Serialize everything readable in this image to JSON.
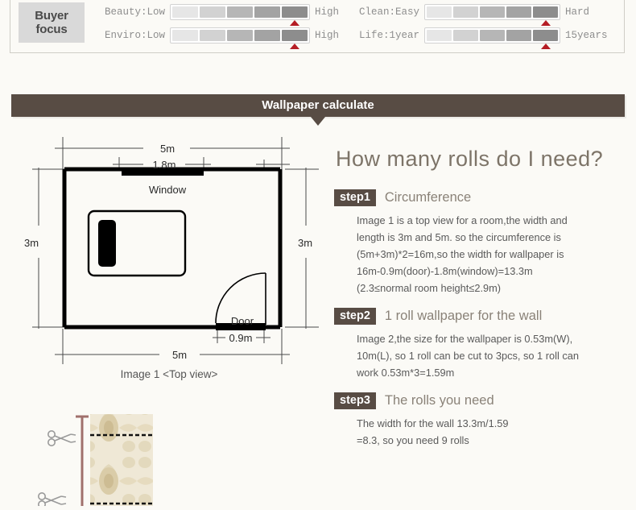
{
  "buyer_focus": {
    "badge_line1": "Buyer",
    "badge_line2": "focus",
    "metrics": [
      {
        "label": "Beauty:Low",
        "end": "High",
        "segments": 5,
        "marker_segment": 5
      },
      {
        "label": "Enviro:Low",
        "end": "High",
        "segments": 5,
        "marker_segment": 5
      },
      {
        "label": "Clean:Easy",
        "end": "Hard",
        "segments": 5,
        "marker_segment": 5
      },
      {
        "label": "Life:1year",
        "end": "15years",
        "segments": 5,
        "marker_segment": 5
      }
    ],
    "segment_colors": [
      "#e6e6e6",
      "#d2d2d2",
      "#b6b6b6",
      "#a3a3a3",
      "#8d8d8d"
    ],
    "marker_color": "#b51d25"
  },
  "section": {
    "title": "Wallpaper calculate",
    "bar_color": "#584c44"
  },
  "diagram": {
    "caption": "Image 1 <Top view>",
    "top_dim": "5m",
    "window_dim": "1.8m",
    "left_dim": "3m",
    "right_dim": "3m",
    "bottom_dim": "5m",
    "door_dim": "0.9m",
    "window_label": "Window",
    "door_label": "Door"
  },
  "rolls": {
    "heading": "How many rolls do I need?",
    "steps": [
      {
        "badge": "step1",
        "title": "Circumference",
        "lines": [
          "Image 1 is a top view for a room,the width and",
          "length is 3m and 5m. so the circumference is",
          "(5m+3m)*2=16m,so the width for wallpaper is",
          "16m-0.9m(door)-1.8m(window)=13.3m",
          "(2.3≤normal room height≤2.9m)"
        ]
      },
      {
        "badge": "step2",
        "title": "1 roll wallpaper for the wall",
        "lines": [
          "Image 2,the size for the wallpaper is 0.53m(W),",
          "10m(L), so 1 roll can be cut to 3pcs, so 1 roll can",
          "work 0.53m*3=1.59m"
        ]
      },
      {
        "badge": "step3",
        "title": "The rolls you need",
        "lines": [
          "The width for the wall 13.3m/1.59",
          "=8.3, so you need 9 rolls"
        ]
      }
    ]
  },
  "roll_illustration": {
    "scissors_icon": "scissors-icon",
    "measure_color": "#a0706c",
    "paper_color": "#e8ddc4"
  }
}
